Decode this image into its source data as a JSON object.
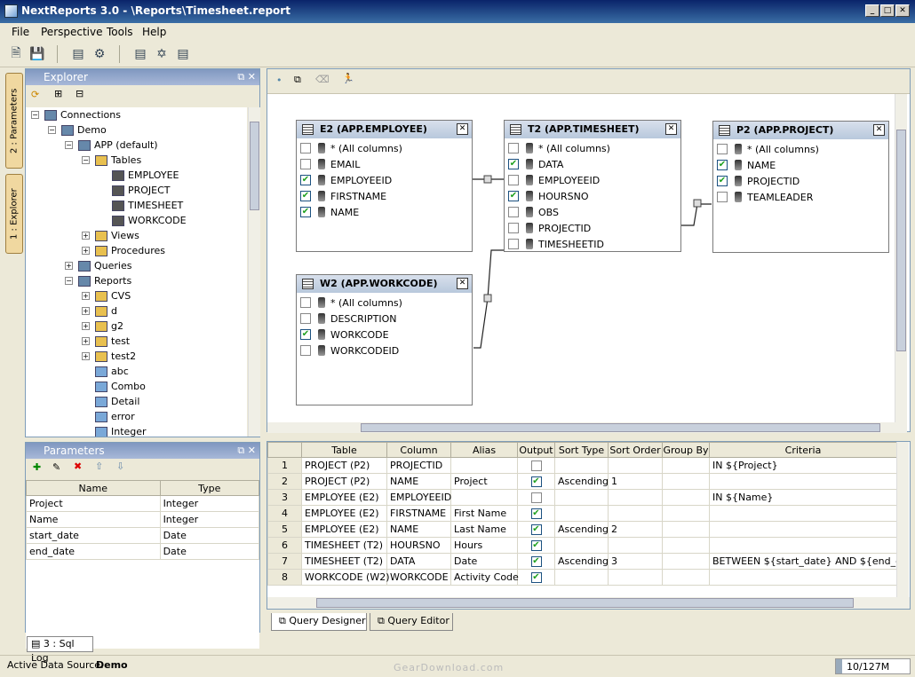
{
  "window": {
    "title": "NextReports 3.0 - \\Reports\\Timesheet.report",
    "buttons": [
      "_",
      "□",
      "✕"
    ]
  },
  "menu": [
    "File",
    "Perspective",
    "Tools",
    "Help"
  ],
  "side_tabs": {
    "parameters": "2 : Parameters",
    "explorer": "1 : Explorer"
  },
  "explorer": {
    "title": "Explorer",
    "tree": [
      {
        "label": "Connections",
        "icon": "connections-icon",
        "exp": "−",
        "d": 0
      },
      {
        "label": "Demo",
        "icon": "database-connection-icon",
        "exp": "−",
        "d": 1
      },
      {
        "label": "APP (default)",
        "icon": "schema-icon",
        "exp": "−",
        "d": 2
      },
      {
        "label": "Tables",
        "icon": "folder-icon",
        "exp": "−",
        "d": 3
      },
      {
        "label": "EMPLOYEE",
        "icon": "table-icon",
        "exp": "",
        "d": 4
      },
      {
        "label": "PROJECT",
        "icon": "table-icon",
        "exp": "",
        "d": 4
      },
      {
        "label": "TIMESHEET",
        "icon": "table-icon",
        "exp": "",
        "d": 4
      },
      {
        "label": "WORKCODE",
        "icon": "table-icon",
        "exp": "",
        "d": 4
      },
      {
        "label": "Views",
        "icon": "folder-icon",
        "exp": "+",
        "d": 3
      },
      {
        "label": "Procedures",
        "icon": "folder-icon",
        "exp": "+",
        "d": 3
      },
      {
        "label": "Queries",
        "icon": "queries-icon",
        "exp": "+",
        "d": 2
      },
      {
        "label": "Reports",
        "icon": "reports-icon",
        "exp": "−",
        "d": 2
      },
      {
        "label": "CVS",
        "icon": "folder-icon",
        "exp": "+",
        "d": 3
      },
      {
        "label": "d",
        "icon": "folder-icon",
        "exp": "+",
        "d": 3
      },
      {
        "label": "g2",
        "icon": "folder-icon",
        "exp": "+",
        "d": 3
      },
      {
        "label": "test",
        "icon": "folder-icon",
        "exp": "+",
        "d": 3
      },
      {
        "label": "test2",
        "icon": "folder-icon",
        "exp": "+",
        "d": 3
      },
      {
        "label": "abc",
        "icon": "report-file-icon",
        "exp": "",
        "d": 3
      },
      {
        "label": "Combo",
        "icon": "report-file-icon",
        "exp": "",
        "d": 3
      },
      {
        "label": "Detail",
        "icon": "report-file-icon",
        "exp": "",
        "d": 3
      },
      {
        "label": "error",
        "icon": "report-file-icon",
        "exp": "",
        "d": 3
      },
      {
        "label": "Integer",
        "icon": "report-file-icon",
        "exp": "",
        "d": 3
      }
    ]
  },
  "parameters": {
    "title": "Parameters",
    "headers": [
      "Name",
      "Type"
    ],
    "rows": [
      [
        "Project",
        "Integer"
      ],
      [
        "Name",
        "Integer"
      ],
      [
        "start_date",
        "Date"
      ],
      [
        "end_date",
        "Date"
      ]
    ]
  },
  "sql_log_tab": "3 : Sql Log",
  "tables": [
    {
      "title": "E2 (APP.EMPLOYEE)",
      "cols": [
        [
          "* (All columns)",
          false,
          "col"
        ],
        [
          "EMAIL",
          false,
          "col"
        ],
        [
          "EMPLOYEEID",
          true,
          "key"
        ],
        [
          "FIRSTNAME",
          true,
          "col"
        ],
        [
          "NAME",
          true,
          "col"
        ]
      ]
    },
    {
      "title": "T2 (APP.TIMESHEET)",
      "cols": [
        [
          "* (All columns)",
          false,
          "col"
        ],
        [
          "DATA",
          true,
          "col"
        ],
        [
          "EMPLOYEEID",
          false,
          "fk"
        ],
        [
          "HOURSNO",
          true,
          "col"
        ],
        [
          "OBS",
          false,
          "col"
        ],
        [
          "PROJECTID",
          false,
          "fk"
        ],
        [
          "TIMESHEETID",
          false,
          "key"
        ]
      ]
    },
    {
      "title": "P2 (APP.PROJECT)",
      "cols": [
        [
          "* (All columns)",
          false,
          "col"
        ],
        [
          "NAME",
          true,
          "col"
        ],
        [
          "PROJECTID",
          true,
          "key"
        ],
        [
          "TEAMLEADER",
          false,
          "col"
        ]
      ]
    },
    {
      "title": "W2 (APP.WORKCODE)",
      "cols": [
        [
          "* (All columns)",
          false,
          "col"
        ],
        [
          "DESCRIPTION",
          false,
          "col"
        ],
        [
          "WORKCODE",
          true,
          "col"
        ],
        [
          "WORKCODEID",
          false,
          "key"
        ]
      ]
    }
  ],
  "grid": {
    "headers": [
      "Table",
      "Column",
      "Alias",
      "Output",
      "Sort Type",
      "Sort Order",
      "Group By",
      "Criteria"
    ],
    "rows": [
      [
        "1",
        "PROJECT (P2)",
        "PROJECTID",
        "",
        false,
        "",
        "",
        "",
        "IN ${Project}"
      ],
      [
        "2",
        "PROJECT (P2)",
        "NAME",
        "Project",
        true,
        "Ascending",
        "1",
        "",
        ""
      ],
      [
        "3",
        "EMPLOYEE (E2)",
        "EMPLOYEEID",
        "",
        false,
        "",
        "",
        "",
        "IN ${Name}"
      ],
      [
        "4",
        "EMPLOYEE (E2)",
        "FIRSTNAME",
        "First Name",
        true,
        "",
        "",
        "",
        ""
      ],
      [
        "5",
        "EMPLOYEE (E2)",
        "NAME",
        "Last Name",
        true,
        "Ascending",
        "2",
        "",
        ""
      ],
      [
        "6",
        "TIMESHEET (T2)",
        "HOURSNO",
        "Hours",
        true,
        "",
        "",
        "",
        ""
      ],
      [
        "7",
        "TIMESHEET (T2)",
        "DATA",
        "Date",
        true,
        "Ascending",
        "3",
        "",
        "BETWEEN ${start_date} AND ${end_date}"
      ],
      [
        "8",
        "WORKCODE (W2)",
        "WORKCODE",
        "Activity Code",
        true,
        "",
        "",
        "",
        ""
      ]
    ]
  },
  "bottom_tabs": [
    "Query Designer",
    "Query Editor"
  ],
  "status": {
    "label": "Active Data Source:",
    "value": "Demo",
    "memory": "10/127M",
    "watermark": "GearDownload.com"
  }
}
